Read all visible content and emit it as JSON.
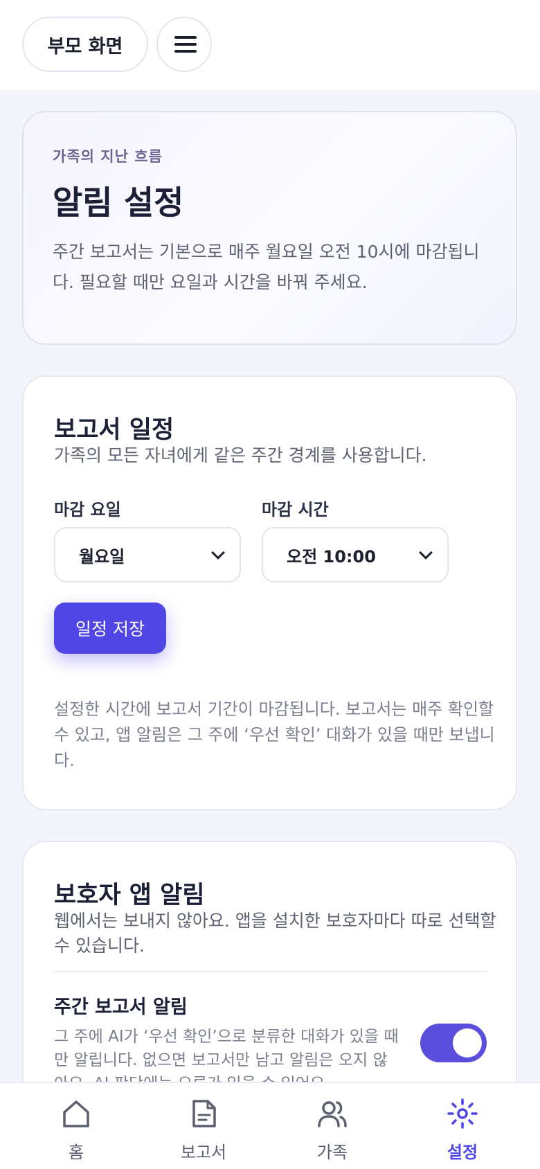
{
  "header": {
    "parent_screen_label": "부모 화면",
    "menu_icon": "hamburger-menu-icon"
  },
  "hero": {
    "eyebrow": "가족의 지난 흐름",
    "title": "알림 설정",
    "description": "주간 보고서는 기본으로 매주 월요일 오전 10시에 마감됩니다. 필요할 때만 요일과 시간을 바꿔 주세요."
  },
  "schedule": {
    "title": "보고서 일정",
    "subtitle": "가족의 모든 자녀에게 같은 주간 경계를 사용합니다.",
    "day_label": "마감 요일",
    "day_value": "월요일",
    "time_label": "마감 시간",
    "time_value": "오전 10:00",
    "save_label": "일정 저장",
    "note": "설정한 시간에 보고서 기간이 마감됩니다. 보고서는 매주 확인할 수 있고, 앱 알림은 그 주에 ‘우선 확인’ 대화가 있을 때만 보냅니다."
  },
  "alerts": {
    "title": "보호자 앱 알림",
    "subtitle": "웹에서는 보내지 않아요. 앱을 설치한 보호자마다 따로 선택할 수 있습니다.",
    "weekly_title": "주간 보고서 알림",
    "weekly_desc": "그 주에 AI가 ‘우선 확인’으로 분류한 대화가 있을 때만 알립니다. 없으면 보고서만 남고 알림은 오지 않아요. AI 판단에는 오류가 있을 수 있어요.",
    "weekly_enabled": true
  },
  "nav": {
    "items": [
      {
        "label": "홈",
        "icon": "home-icon"
      },
      {
        "label": "보고서",
        "icon": "document-icon"
      },
      {
        "label": "가족",
        "icon": "people-icon"
      },
      {
        "label": "설정",
        "icon": "sun-settings-icon",
        "active": true
      }
    ]
  },
  "colors": {
    "accent": "#4f46e5",
    "toggle_on": "#5a4fdc",
    "background": "#f4f5fa"
  }
}
